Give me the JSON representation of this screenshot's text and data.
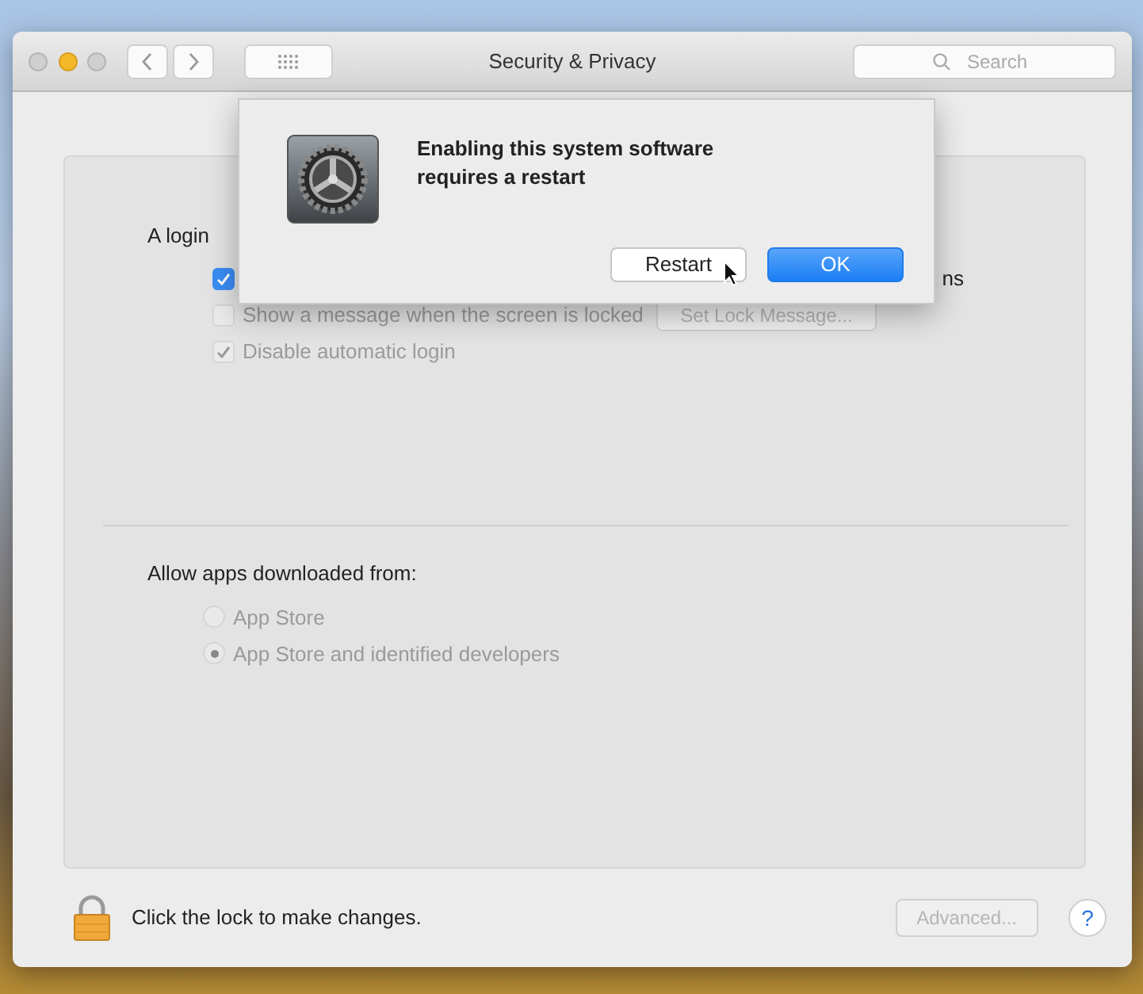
{
  "window": {
    "title": "Security & Privacy",
    "search": {
      "placeholder": "Search"
    },
    "traffic_lights": [
      {
        "color": "#cfcfcf"
      },
      {
        "color": "#f5b829"
      },
      {
        "color": "#cfcfcf"
      }
    ]
  },
  "login_section": {
    "label": "A login",
    "options": [
      {
        "label": "ns",
        "checked": true,
        "disabled": false
      },
      {
        "label": "Show a message when the screen is locked",
        "checked": false,
        "disabled": true,
        "button": {
          "label": "Set Lock Message...",
          "disabled": true
        }
      },
      {
        "label": "Disable automatic login",
        "checked": true,
        "disabled": true
      }
    ]
  },
  "allow_apps": {
    "label": "Allow apps downloaded from:",
    "options": [
      {
        "label": "App Store",
        "selected": false,
        "disabled": true
      },
      {
        "label": "App Store and identified developers",
        "selected": true,
        "disabled": true
      }
    ]
  },
  "footer": {
    "lock_text": "Click the lock to make changes.",
    "advanced": {
      "label": "Advanced...",
      "disabled": true
    },
    "help": "?"
  },
  "dialog": {
    "message": "Enabling this system software requires a restart",
    "buttons": [
      {
        "label": "Restart",
        "default": false
      },
      {
        "label": "OK",
        "default": true
      }
    ]
  }
}
